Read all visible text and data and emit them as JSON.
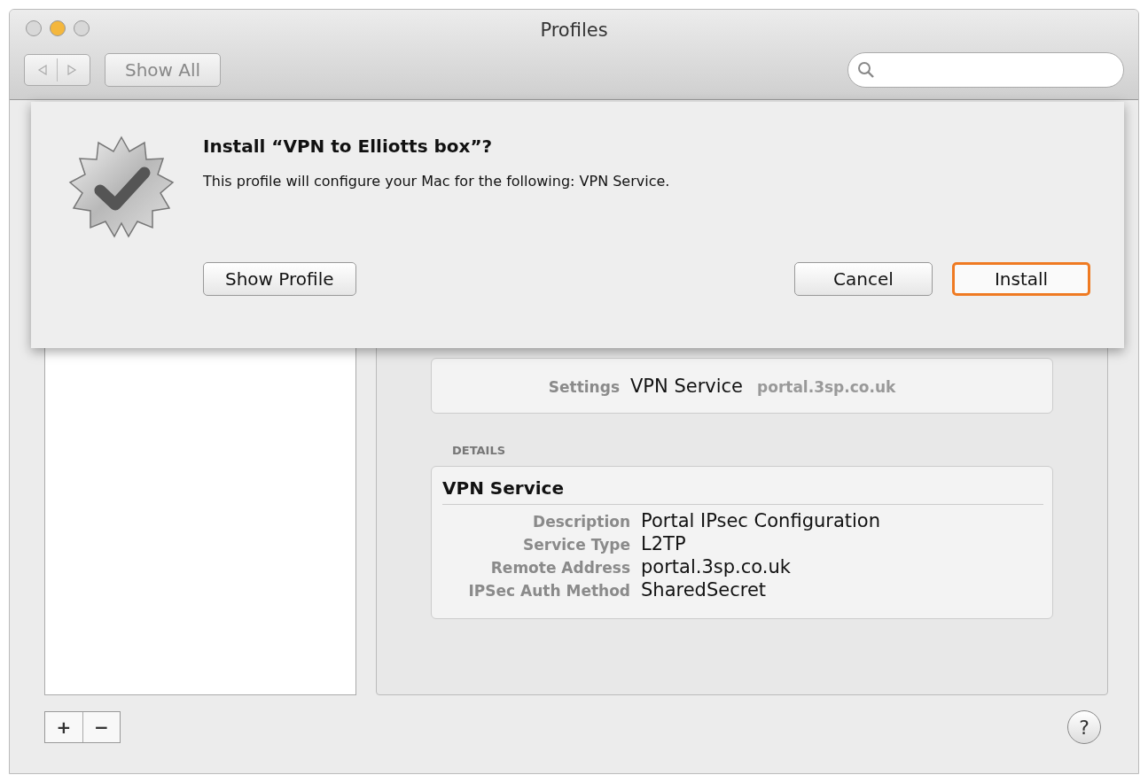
{
  "window": {
    "title": "Profiles",
    "traffic_lights": [
      {
        "kind": "close",
        "lit": false
      },
      {
        "kind": "minimize",
        "lit": true
      },
      {
        "kind": "zoom",
        "lit": false
      }
    ]
  },
  "toolbar": {
    "show_all": "Show All"
  },
  "settings": {
    "label": "Settings",
    "value": "VPN Service",
    "detail": "portal.3sp.co.uk"
  },
  "details": {
    "heading": "DETAILS",
    "title": "VPN Service",
    "rows": [
      {
        "label": "Description",
        "value": "Portal IPsec Configuration"
      },
      {
        "label": "Service Type",
        "value": "L2TP"
      },
      {
        "label": "Remote Address",
        "value": "portal.3sp.co.uk"
      },
      {
        "label": "IPSec Auth Method",
        "value": "SharedSecret"
      }
    ]
  },
  "list_buttons": [
    "+",
    "−"
  ],
  "help": "?",
  "sheet": {
    "title": "Install “VPN to Elliotts box”?",
    "message": "This profile will configure your Mac for the following: VPN Service.",
    "buttons": [
      {
        "label": "Show Profile",
        "focused": false
      },
      {
        "label": "Cancel",
        "focused": false
      },
      {
        "label": "Install",
        "focused": true
      }
    ]
  }
}
